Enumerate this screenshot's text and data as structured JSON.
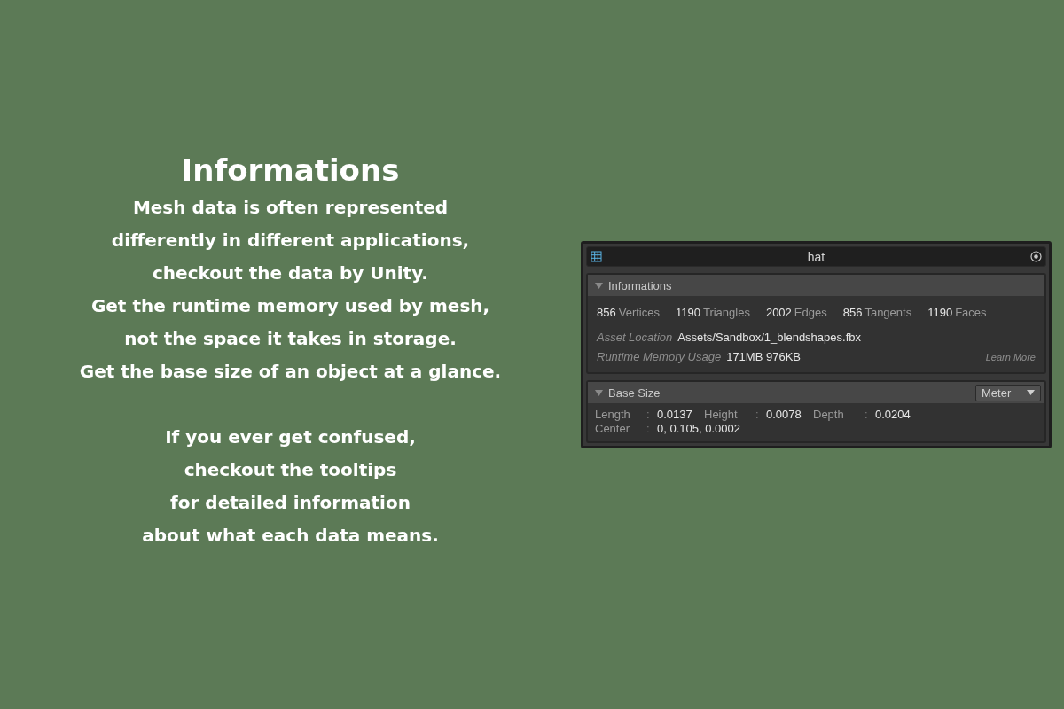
{
  "headline": "Informations",
  "description": [
    [
      "Mesh data is often represented",
      "differently in different applications,",
      "checkout the data by Unity.",
      "Get the runtime memory used by mesh,",
      "not the space it takes in storage.",
      "Get the base size of an object at a glance."
    ],
    [
      "If you ever get confused,",
      "checkout the tooltips",
      "for detailed information",
      "about what each data means."
    ]
  ],
  "panel": {
    "title": "hat",
    "sections": [
      {
        "kind": "info",
        "title": "Informations",
        "expanded": true,
        "stats": [
          {
            "count": "856",
            "unit": "Vertices"
          },
          {
            "count": "1190",
            "unit": "Triangles"
          },
          {
            "count": "2002",
            "unit": "Edges"
          },
          {
            "count": "856",
            "unit": "Tangents"
          },
          {
            "count": "1190",
            "unit": "Faces"
          }
        ],
        "fields": [
          {
            "label": "Asset Location",
            "value": "Assets/Sandbox/1_blendshapes.fbx"
          },
          {
            "label": "Runtime Memory Usage",
            "value": "171MB 976KB"
          }
        ],
        "link": "Learn More"
      },
      {
        "kind": "size",
        "title": "Base Size",
        "expanded": true,
        "unit": "Meter",
        "rows": [
          [
            {
              "label": "Length",
              "separator": ":",
              "value": "0.0137"
            },
            {
              "label": "Height",
              "separator": ":",
              "value": "0.0078"
            },
            {
              "label": "Depth",
              "separator": ":",
              "value": "0.0204"
            }
          ],
          [
            {
              "label": "Center",
              "separator": ":",
              "value": "0, 0.105, 0.0002"
            }
          ]
        ]
      }
    ]
  }
}
